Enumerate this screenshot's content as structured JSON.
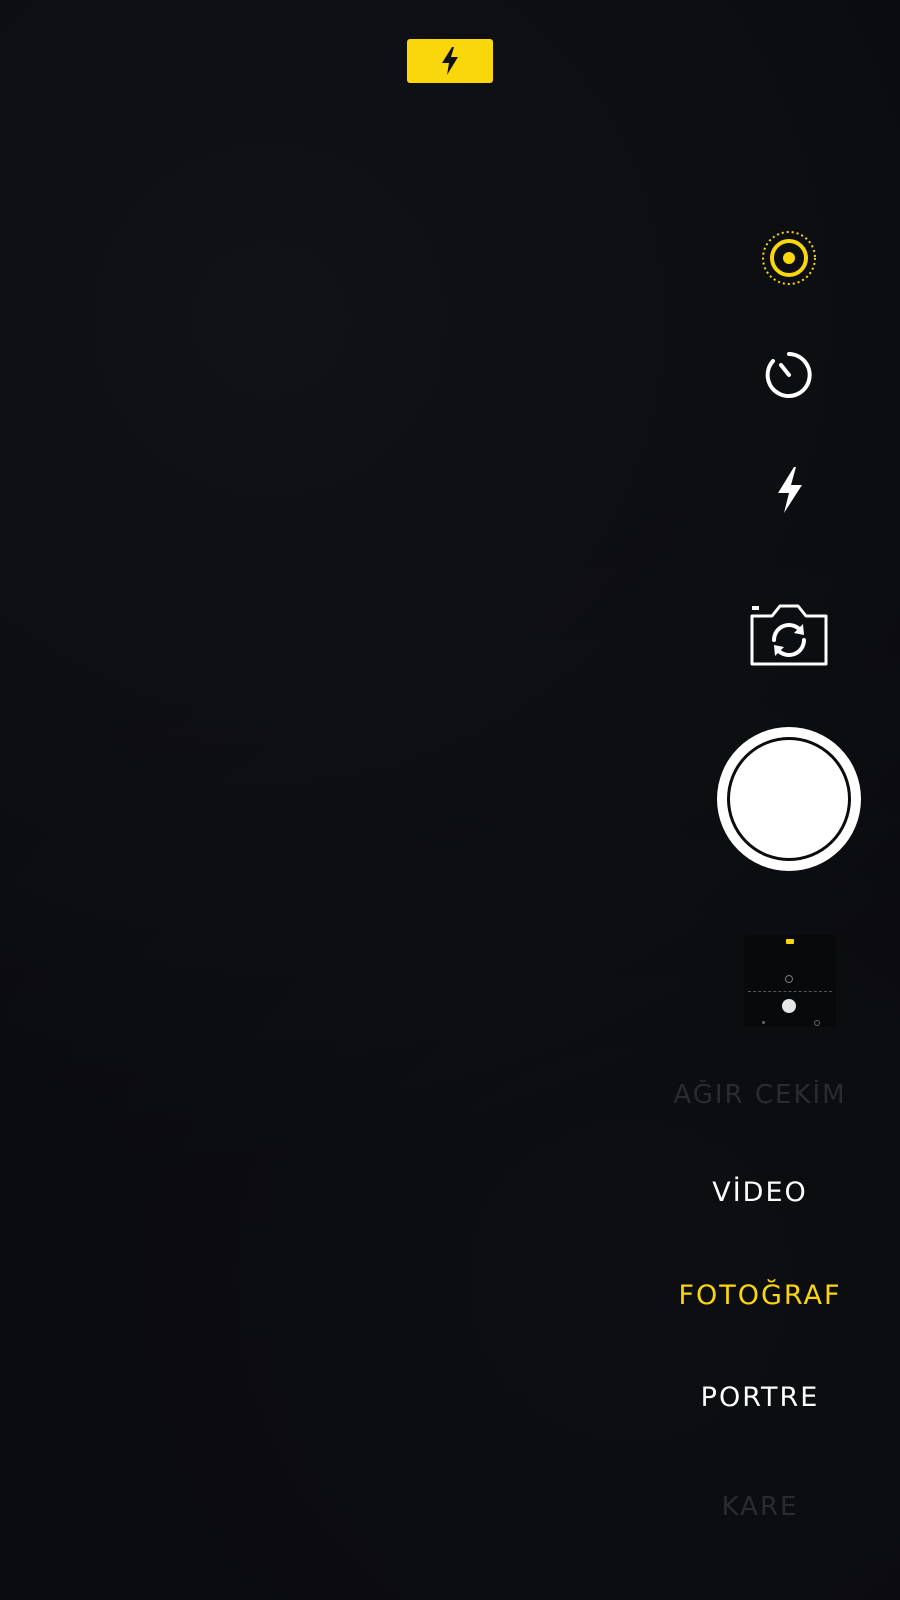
{
  "top_bar": {
    "flash_indicator_icon": "flash-bolt-icon",
    "flash_indicator_color": "#f9d70b"
  },
  "side_controls": [
    {
      "id": "live-photo",
      "icon": "live-photo-icon",
      "active": true,
      "color": "#f9d70b"
    },
    {
      "id": "timer",
      "icon": "timer-icon",
      "active": false,
      "color": "#ffffff"
    },
    {
      "id": "flash",
      "icon": "flash-icon",
      "active": false,
      "color": "#ffffff"
    },
    {
      "id": "switch-camera",
      "icon": "camera-flip-icon",
      "active": false,
      "color": "#ffffff"
    }
  ],
  "shutter": {
    "icon": "shutter-button"
  },
  "thumbnail": {
    "icon": "last-photo-thumbnail"
  },
  "modes": {
    "slowmo": "AĞIR ÇEKİM",
    "video": "VİDEO",
    "photo": "FOTOĞRAF",
    "portrait": "PORTRE",
    "square": "KARE",
    "selected": "FOTOĞRAF"
  },
  "colors": {
    "accent": "#f9d70b",
    "background": "#0a0b0e",
    "text": "#ffffff"
  }
}
